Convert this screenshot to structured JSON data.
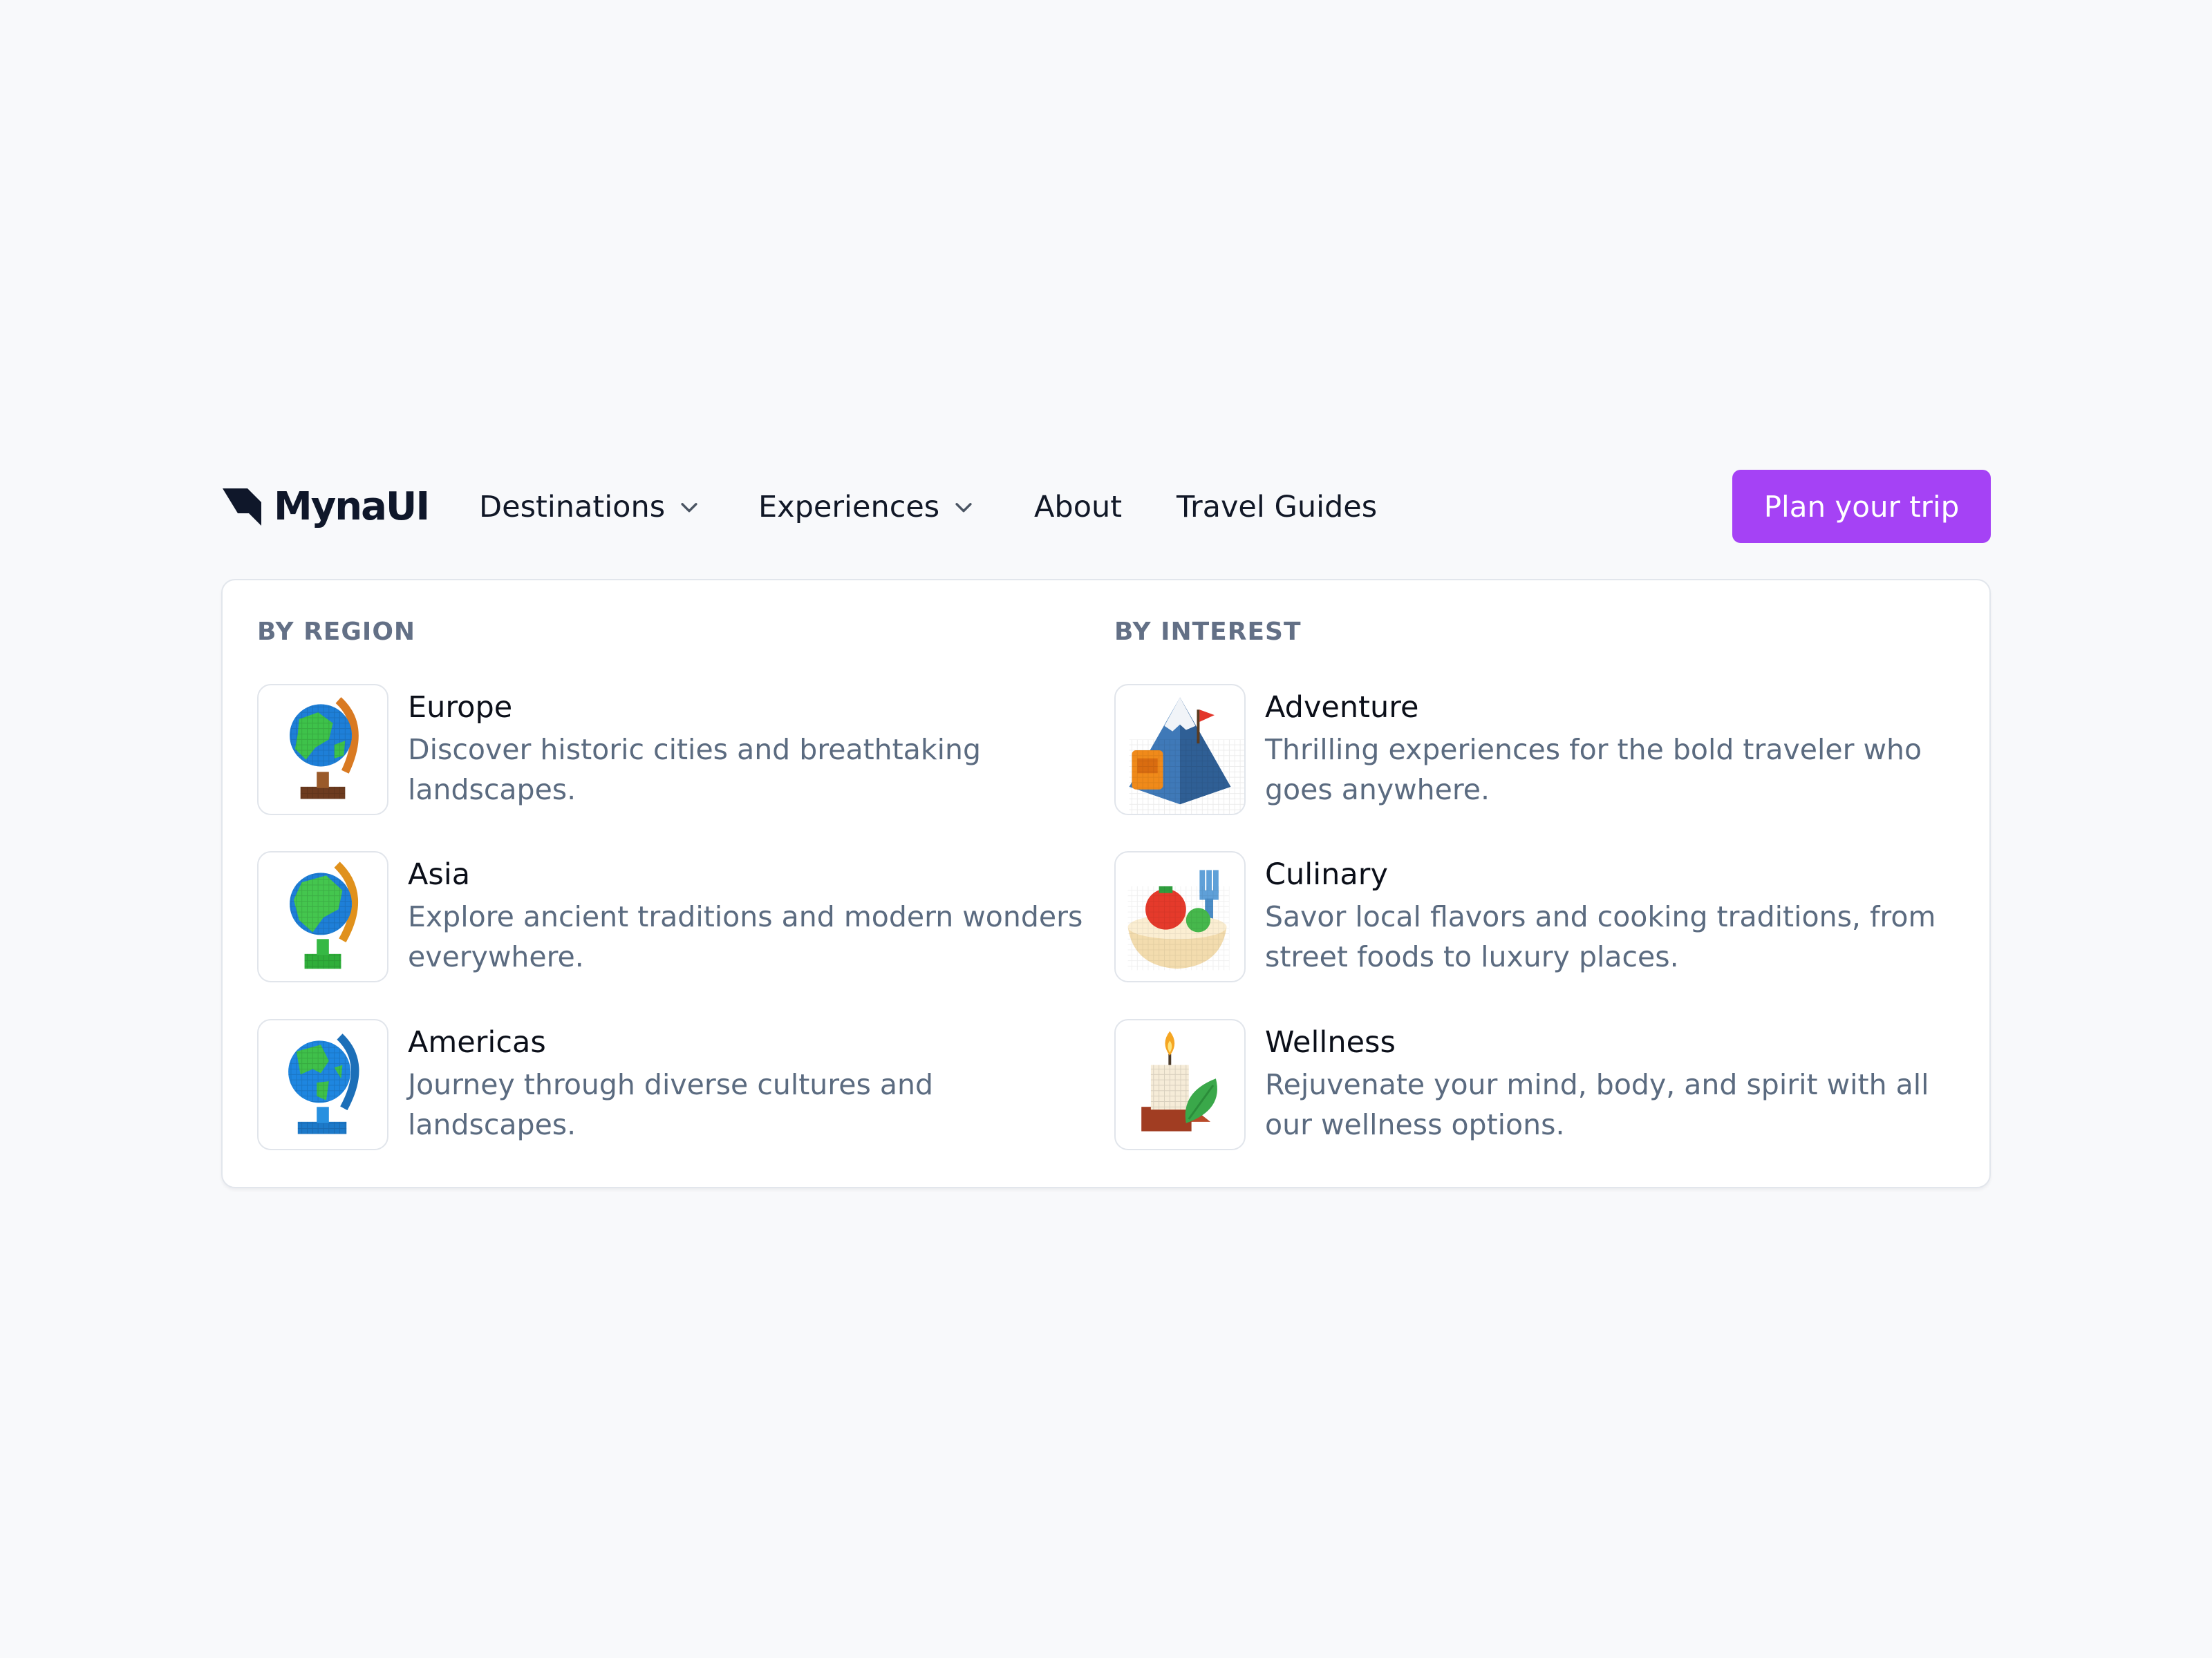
{
  "brand": {
    "name": "MynaUI"
  },
  "nav": {
    "destinations": "Destinations",
    "experiences": "Experiences",
    "about": "About",
    "travel_guides": "Travel Guides",
    "cta": "Plan your trip"
  },
  "colors": {
    "accent": "#a542f5",
    "heading": "#637086",
    "description": "#5b6b80"
  },
  "menu": {
    "region": {
      "heading": "BY REGION",
      "items": [
        {
          "title": "Europe",
          "description": "Discover historic cities and breathtaking landscapes.",
          "icon": "globe-europe-icon"
        },
        {
          "title": "Asia",
          "description": "Explore ancient traditions and modern wonders everywhere.",
          "icon": "globe-asia-icon"
        },
        {
          "title": "Americas",
          "description": "Journey through diverse cultures and landscapes.",
          "icon": "globe-americas-icon"
        }
      ]
    },
    "interest": {
      "heading": "BY INTEREST",
      "items": [
        {
          "title": "Adventure",
          "description": "Thrilling experiences for the bold traveler who goes anywhere.",
          "icon": "mountain-icon"
        },
        {
          "title": "Culinary",
          "description": "Savor local flavors and cooking traditions, from street foods to luxury places.",
          "icon": "food-bowl-icon"
        },
        {
          "title": "Wellness",
          "description": "Rejuvenate your mind, body, and spirit with all our wellness options.",
          "icon": "candle-leaf-icon"
        }
      ]
    }
  }
}
